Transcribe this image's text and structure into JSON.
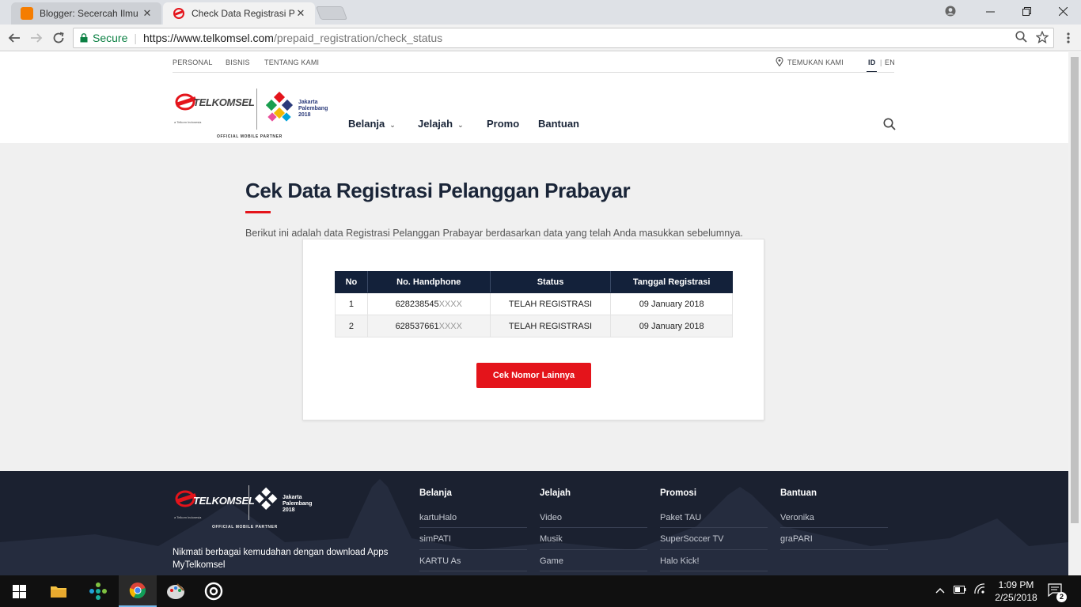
{
  "browser": {
    "tabs": [
      {
        "title": "Blogger: Secercah Ilmu -",
        "favicon_color": "#f57d00",
        "active": false
      },
      {
        "title": "Check Data Registrasi Pr",
        "favicon_color": "#e4141b",
        "active": true
      }
    ],
    "close_glyph": "✕",
    "secure_label": "Secure",
    "url_main": "https://www.telkomsel.com",
    "url_path": "/prepaid_registration/check_status"
  },
  "header": {
    "topnav": [
      "PERSONAL",
      "BISNIS",
      "TENTANG KAMI"
    ],
    "store_locator": "TEMUKAN KAMI",
    "lang_id": "ID",
    "lang_sep": "|",
    "lang_en": "EN",
    "logo_brand": "TELKOMSEL",
    "logo_sub": "a Telkom Indonesia",
    "asian_games_line1": "Jakarta",
    "asian_games_line2": "Palembang",
    "asian_games_line3": "2018",
    "official_partner": "OFFICIAL MOBILE PARTNER",
    "mainnav": [
      {
        "label": "Belanja",
        "dropdown": true
      },
      {
        "label": "Jelajah",
        "dropdown": true
      },
      {
        "label": "Promo",
        "dropdown": false
      },
      {
        "label": "Bantuan",
        "dropdown": false
      }
    ]
  },
  "main": {
    "title": "Cek Data Registrasi Pelanggan Prabayar",
    "description": "Berikut ini adalah data Registrasi Pelanggan Prabayar berdasarkan data yang telah Anda masukkan sebelumnya.",
    "table": {
      "headers": [
        "No",
        "No. Handphone",
        "Status",
        "Tanggal Registrasi"
      ],
      "rows": [
        {
          "no": "1",
          "phone": "628238545",
          "mask": "XXXX",
          "status": "TELAH REGISTRASI",
          "date": "09 January 2018"
        },
        {
          "no": "2",
          "phone": "628537661",
          "mask": "XXXX",
          "status": "TELAH REGISTRASI",
          "date": "09 January 2018"
        }
      ]
    },
    "button_label": "Cek Nomor Lainnya"
  },
  "footer": {
    "download_text": "Nikmati berbagai kemudahan dengan download Apps MyTelkomsel",
    "columns": [
      {
        "title": "Belanja",
        "links": [
          "kartuHalo",
          "simPATI",
          "KARTU As"
        ]
      },
      {
        "title": "Jelajah",
        "links": [
          "Video",
          "Musik",
          "Game"
        ]
      },
      {
        "title": "Promosi",
        "links": [
          "Paket TAU",
          "SuperSoccer TV",
          "Halo Kick!"
        ]
      },
      {
        "title": "Bantuan",
        "links": [
          "Veronika",
          "graPARI"
        ]
      }
    ]
  },
  "taskbar": {
    "time": "1:09 PM",
    "date": "2/25/2018",
    "notification_count": "2"
  },
  "colors": {
    "brand_red": "#e4141b",
    "navy": "#13213a",
    "secure_green": "#0b8043"
  }
}
